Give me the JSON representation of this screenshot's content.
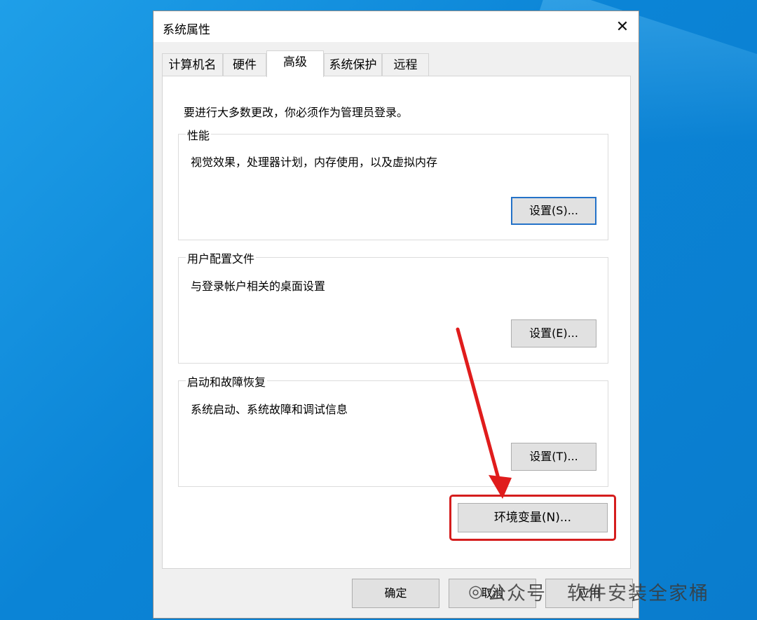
{
  "window": {
    "title": "系统属性"
  },
  "tabs": [
    {
      "label": "计算机名",
      "active": false
    },
    {
      "label": "硬件",
      "active": false
    },
    {
      "label": "高级",
      "active": true
    },
    {
      "label": "系统保护",
      "active": false
    },
    {
      "label": "远程",
      "active": false
    }
  ],
  "panel": {
    "notice": "要进行大多数更改，你必须作为管理员登录。",
    "performance": {
      "title": "性能",
      "desc": "视觉效果，处理器计划，内存使用，以及虚拟内存",
      "button": "设置(S)..."
    },
    "profiles": {
      "title": "用户配置文件",
      "desc": "与登录帐户相关的桌面设置",
      "button": "设置(E)..."
    },
    "startup": {
      "title": "启动和故障恢复",
      "desc": "系统启动、系统故障和调试信息",
      "button": "设置(T)..."
    },
    "env_button": "环境变量(N)..."
  },
  "footer": {
    "ok": "确定",
    "cancel": "取消",
    "apply": "应用"
  },
  "watermark": {
    "label": "公众号",
    "brand": "软件安装全家桶"
  },
  "colors": {
    "highlight": "#d51d1d",
    "desktop": "#0b84d6"
  }
}
